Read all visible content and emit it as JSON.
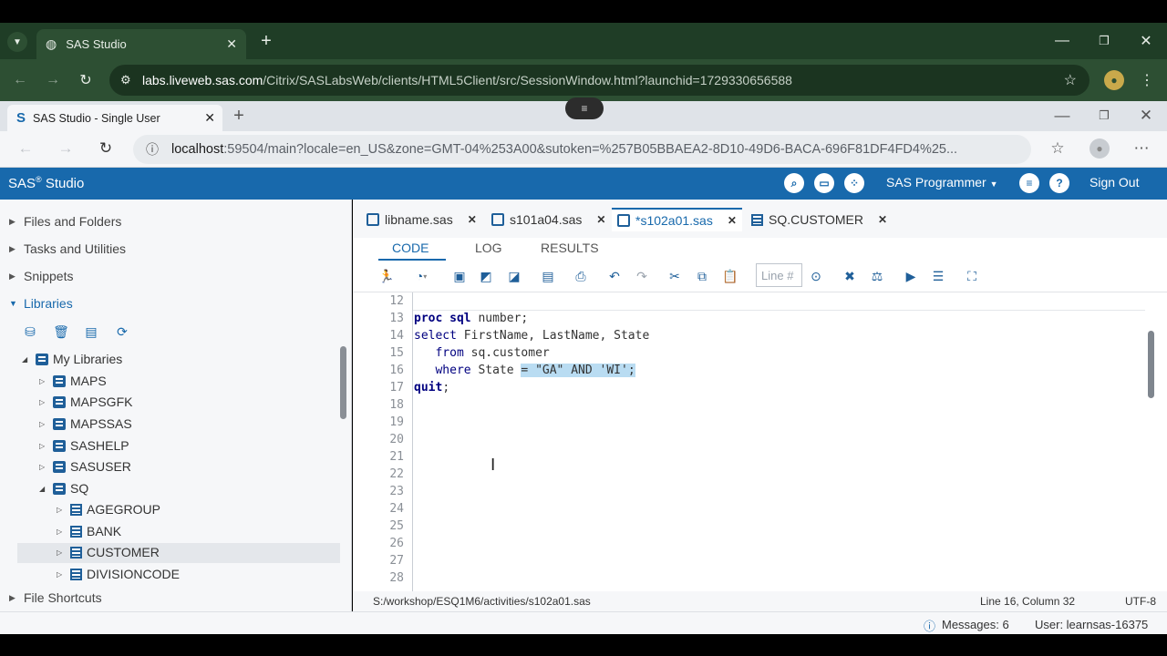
{
  "outer_browser": {
    "tab_title": "SAS Studio",
    "url_host": "labs.liveweb.sas.com",
    "url_rest": "/Citrix/SASLabsWeb/clients/HTML5Client/src/SessionWindow.html?launchid=1729330656588"
  },
  "inner_browser": {
    "tab_title": "SAS Studio - Single User",
    "url_host": "localhost",
    "url_rest": ":59504/main?locale=en_US&zone=GMT-04%253A00&sutoken=%257B05BBAEA2-8D10-49D6-BACA-696F81DF4FD4%25..."
  },
  "sas_header": {
    "brand": "SAS",
    "brand_mark": "®",
    "brand_suffix": "Studio",
    "role": "SAS Programmer",
    "sign_out": "Sign Out"
  },
  "left_panel": {
    "sections": [
      "Files and Folders",
      "Tasks and Utilities",
      "Snippets",
      "Libraries"
    ],
    "my_libraries": "My Libraries",
    "libraries": [
      "MAPS",
      "MAPSGFK",
      "MAPSSAS",
      "SASHELP",
      "SASUSER",
      "SQ"
    ],
    "sq_tables": [
      "AGEGROUP",
      "BANK",
      "CUSTOMER",
      "DIVISIONCODE"
    ],
    "file_shortcuts": "File Shortcuts"
  },
  "editor_tabs": [
    "libname.sas",
    "s101a04.sas",
    "*s102a01.sas",
    "SQ.CUSTOMER"
  ],
  "sub_tabs": [
    "CODE",
    "LOG",
    "RESULTS"
  ],
  "line_placeholder": "Line #",
  "code": {
    "line_numbers": [
      "12",
      "13",
      "14",
      "15",
      "16",
      "17",
      "18",
      "19",
      "20",
      "21",
      "22",
      "23",
      "24",
      "25",
      "26",
      "27",
      "28"
    ],
    "l13_kw": "proc sql",
    "l13_rest": " number;",
    "l14_kw": "select",
    "l14_rest": " FirstName, LastName, State",
    "l15_kw": "from",
    "l15_rest": " sq.customer",
    "l16_kw": "where",
    "l16_rest": " State ",
    "l16_hl": "= \"GA\" AND 'WI';",
    "l17_kw": "quit",
    "l17_rest": ";"
  },
  "status": {
    "path": "S:/workshop/ESQ1M6/activities/s102a01.sas",
    "position": "Line 16, Column 32",
    "encoding": "UTF-8"
  },
  "bottom": {
    "messages": "Messages: 6",
    "user": "User: learnsas-16375"
  },
  "colors": {
    "sas_blue": "#1869ac",
    "highlight": "#b9dcf2",
    "outer_chrome": "#2d4f33"
  }
}
